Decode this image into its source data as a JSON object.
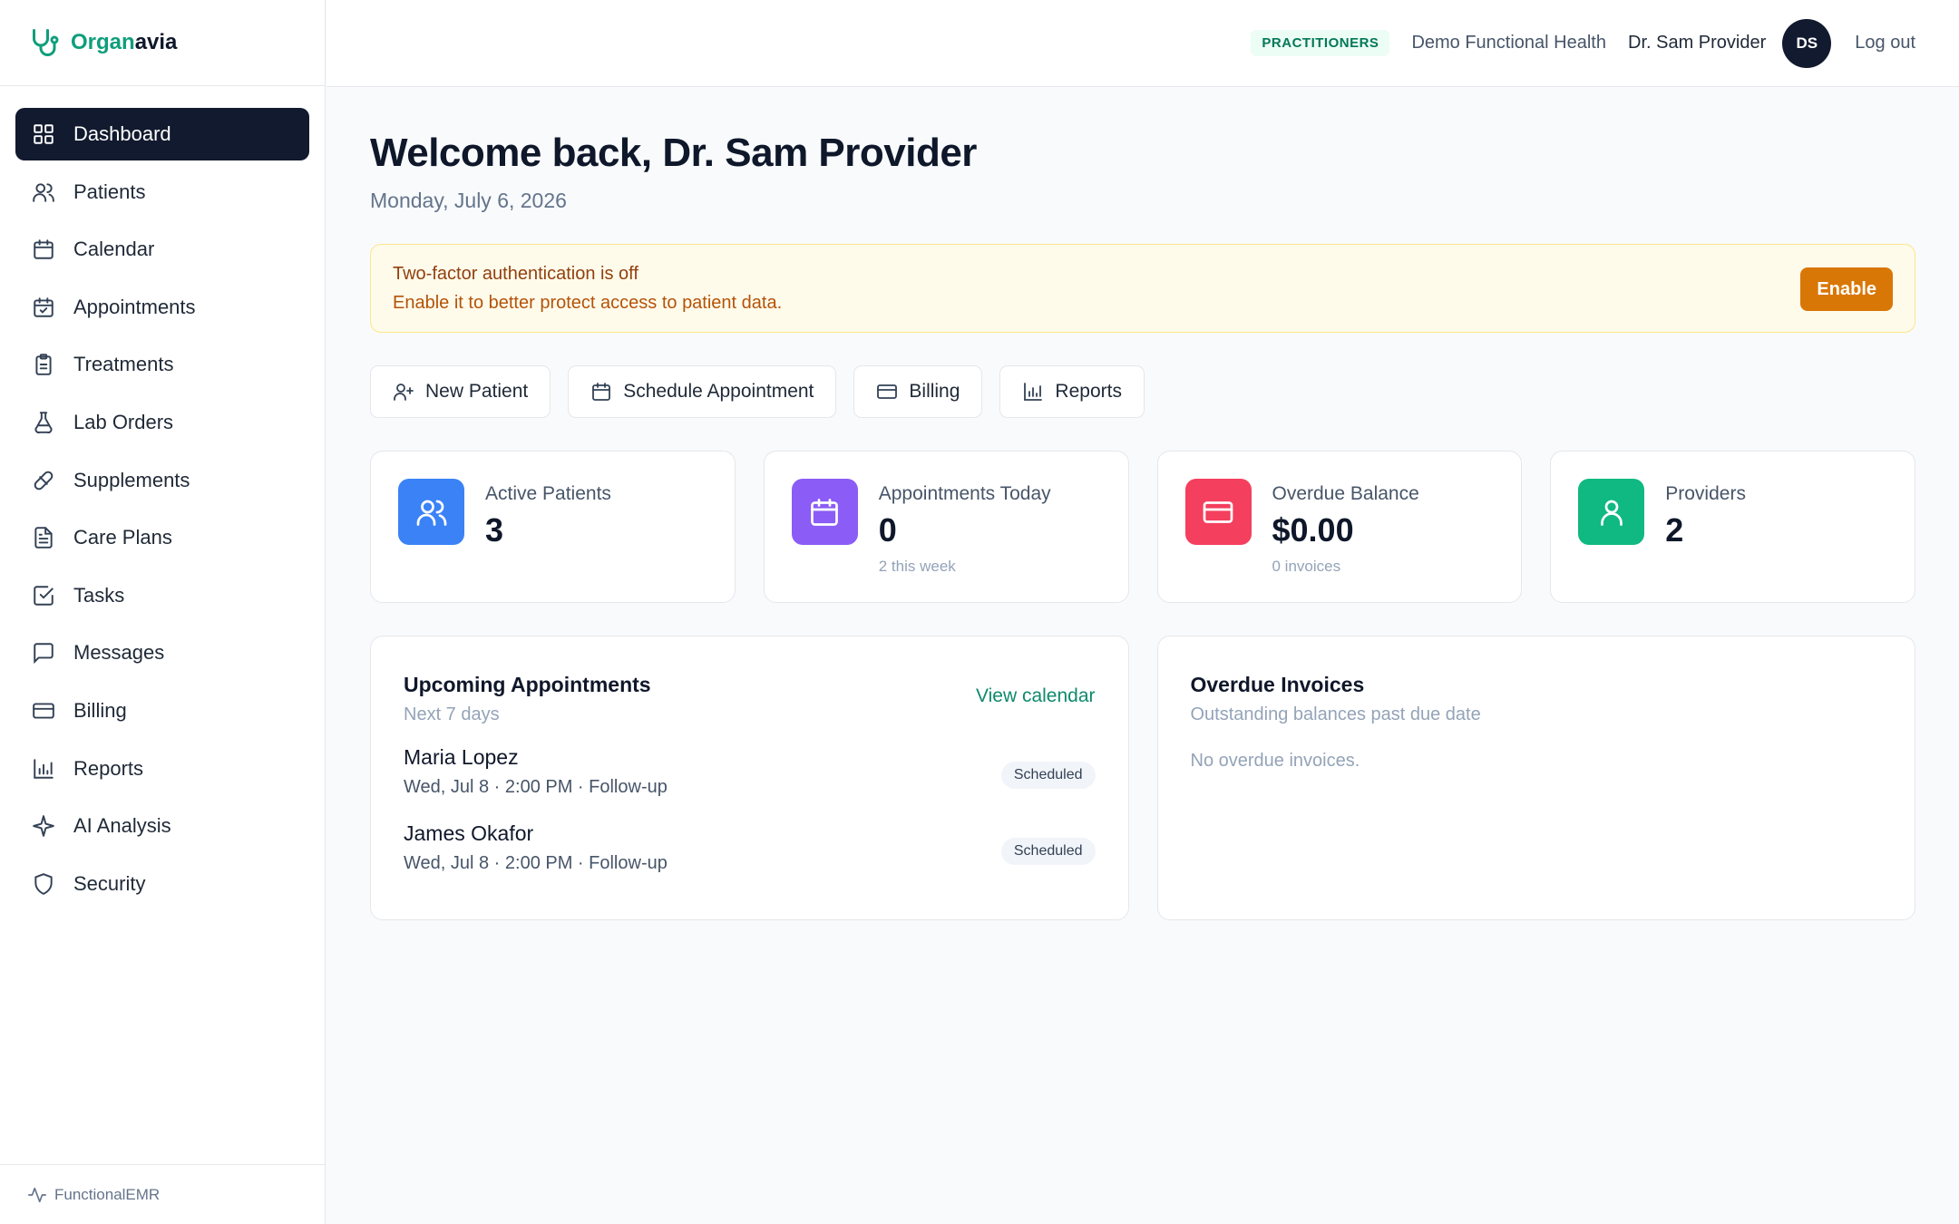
{
  "brand": {
    "name_part1": "Organ",
    "name_part2": "avia",
    "accent": "#0f9e7b"
  },
  "sidebar": {
    "items": [
      {
        "label": "Dashboard",
        "icon": "grid-icon",
        "active": true
      },
      {
        "label": "Patients",
        "icon": "users-icon"
      },
      {
        "label": "Calendar",
        "icon": "calendar-icon"
      },
      {
        "label": "Appointments",
        "icon": "calendar-check-icon"
      },
      {
        "label": "Treatments",
        "icon": "clipboard-icon"
      },
      {
        "label": "Lab Orders",
        "icon": "flask-icon"
      },
      {
        "label": "Supplements",
        "icon": "pill-icon"
      },
      {
        "label": "Care Plans",
        "icon": "file-text-icon"
      },
      {
        "label": "Tasks",
        "icon": "check-square-icon"
      },
      {
        "label": "Messages",
        "icon": "message-icon"
      },
      {
        "label": "Billing",
        "icon": "credit-card-icon"
      },
      {
        "label": "Reports",
        "icon": "bar-chart-icon"
      },
      {
        "label": "AI Analysis",
        "icon": "sparkle-icon"
      },
      {
        "label": "Security",
        "icon": "shield-icon"
      }
    ],
    "footer": "FunctionalEMR"
  },
  "header": {
    "role_badge": "PRACTITIONERS",
    "org_name": "Demo Functional Health",
    "user_name": "Dr. Sam Provider",
    "avatar_initials": "DS",
    "logout_label": "Log out"
  },
  "main": {
    "welcome": "Welcome back, Dr. Sam Provider",
    "date": "Monday, July 6, 2026",
    "alert": {
      "title": "Two-factor authentication is off",
      "description": "Enable it to better protect access to patient data.",
      "button": "Enable"
    },
    "quick_actions": [
      {
        "label": "New Patient",
        "icon": "user-plus-icon"
      },
      {
        "label": "Schedule Appointment",
        "icon": "calendar-icon"
      },
      {
        "label": "Billing",
        "icon": "credit-card-icon"
      },
      {
        "label": "Reports",
        "icon": "bar-chart-icon"
      }
    ],
    "stats": [
      {
        "label": "Active Patients",
        "value": "3",
        "sub": "",
        "icon": "users-icon",
        "color": "#3b82f6"
      },
      {
        "label": "Appointments Today",
        "value": "0",
        "sub": "2 this week",
        "icon": "calendar-icon",
        "color": "#8b5cf6"
      },
      {
        "label": "Overdue Balance",
        "value": "$0.00",
        "sub": "0 invoices",
        "icon": "credit-card-icon",
        "color": "#f43f5e"
      },
      {
        "label": "Providers",
        "value": "2",
        "sub": "",
        "icon": "user-icon",
        "color": "#10b981"
      }
    ],
    "upcoming": {
      "title": "Upcoming Appointments",
      "subtitle": "Next 7 days",
      "link": "View calendar",
      "items": [
        {
          "name": "Maria Lopez",
          "meta": "Wed, Jul 8 · 2:00 PM · Follow-up",
          "status": "Scheduled"
        },
        {
          "name": "James Okafor",
          "meta": "Wed, Jul 8 · 2:00 PM · Follow-up",
          "status": "Scheduled"
        }
      ]
    },
    "overdue": {
      "title": "Overdue Invoices",
      "subtitle": "Outstanding balances past due date",
      "empty": "No overdue invoices."
    }
  }
}
